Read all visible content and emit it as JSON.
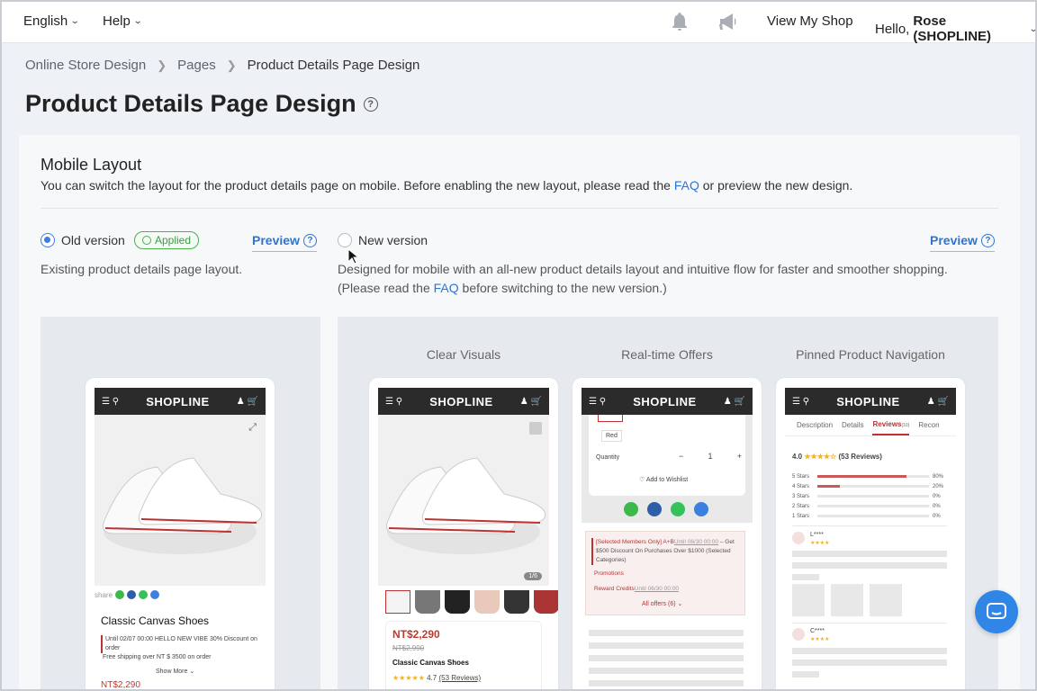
{
  "topbar": {
    "language": "English",
    "help": "Help",
    "view_shop": "View My Shop",
    "greeting": "Hello,",
    "user": "Rose (SHOPLINE)",
    "icons": [
      "bell-icon",
      "megaphone-icon"
    ]
  },
  "breadcrumb": [
    "Online Store Design",
    "Pages",
    "Product Details Page Design"
  ],
  "page_title": "Product Details Page Design",
  "section": {
    "title": "Mobile Layout",
    "desc_before": "You can switch the layout for the product details page on mobile. Before enabling the new layout, please read the ",
    "desc_link": "FAQ",
    "desc_after": " or preview the new design."
  },
  "old_version": {
    "label": "Old version",
    "badge": "Applied",
    "preview": "Preview",
    "desc": "Existing product details page layout.",
    "selected": true
  },
  "new_version": {
    "label": "New version",
    "preview": "Preview",
    "desc_line1": "Designed for mobile with an all-new product details layout and intuitive flow for faster and smoother shopping.",
    "desc_before": "(Please read the ",
    "desc_link": "FAQ",
    "desc_after": " before switching to the new version.)",
    "selected": false
  },
  "captions": [
    "Clear Visuals",
    "Real-time Offers",
    "Pinned Product Navigation"
  ],
  "mock": {
    "logo": "SHOPLINE",
    "old_phone": {
      "share": "share",
      "product": "Classic Canvas Shoes",
      "promo": "Until 02/07 00:00 HELLO NEW VIBE 30% Discount on order",
      "shipping": "Free shipping over NT $ 3500 on order",
      "show_more": "Show More",
      "price": "NT$2,290"
    },
    "phone1": {
      "counter": "1/6",
      "price": "NT$2,290",
      "old_price": "NT$2,990",
      "product": "Classic Canvas Shoes",
      "rating": "4.7",
      "reviews": "(53 Reviews)"
    },
    "phone2": {
      "color": "Red",
      "quantity_label": "Quantity",
      "qty_minus": "−",
      "quantity": "1",
      "qty_plus": "+",
      "wishlist": "Add to Wishlist",
      "offer1_tag": "[Selected Members Only] A+B",
      "offer1_date": "Until 06/30 00:00",
      "offer1_text": "– Get $500 Discount On Purchases Over $1000 (Selected Categories)",
      "promotions": "Promotions",
      "reward": "Reward Credits",
      "reward_date": "Until 06/30 00:00",
      "all_offers": "All offers (6)"
    },
    "phone3": {
      "tabs": [
        "Description",
        "Details",
        "Reviews",
        "Recon"
      ],
      "reviews_count": "(10)",
      "rating": "4.0",
      "reviews": "(53 Reviews)",
      "stars": [
        {
          "label": "5 Stars",
          "pct": "80%",
          "value": 80
        },
        {
          "label": "4 Stars",
          "pct": "20%",
          "value": 20
        },
        {
          "label": "3 Stars",
          "pct": "0%",
          "value": 0
        },
        {
          "label": "2 Stars",
          "pct": "0%",
          "value": 0
        },
        {
          "label": "1 Stars",
          "pct": "0%",
          "value": 0
        }
      ],
      "reviewer1": "L****",
      "reviewer2": "C****"
    }
  }
}
